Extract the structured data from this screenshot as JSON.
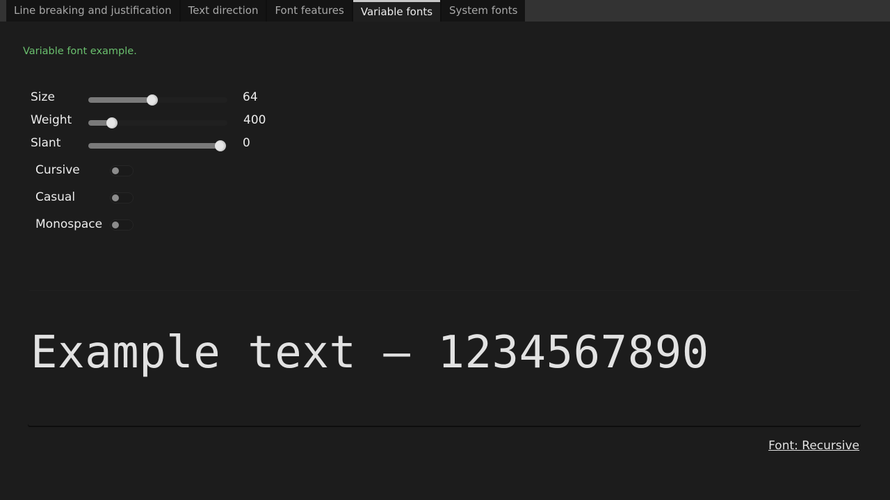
{
  "tabs": [
    {
      "label": "Line breaking and justification",
      "active": false
    },
    {
      "label": "Text direction",
      "active": false
    },
    {
      "label": "Font features",
      "active": false
    },
    {
      "label": "Variable fonts",
      "active": true
    },
    {
      "label": "System fonts",
      "active": false
    }
  ],
  "description": "Variable font example.",
  "description_color": "#6abf6e",
  "controls": {
    "sliders": [
      {
        "label": "Size",
        "value": "64",
        "fraction": 0.46
      },
      {
        "label": "Weight",
        "value": "400",
        "fraction": 0.17
      },
      {
        "label": "Slant",
        "value": "0",
        "fraction": 0.95
      }
    ],
    "toggles": [
      {
        "label": "Cursive",
        "on": false
      },
      {
        "label": "Casual",
        "on": false
      },
      {
        "label": "Monospace",
        "on": false
      }
    ]
  },
  "preview": {
    "text": "Example text – 1234567890"
  },
  "font_link": "Font: Recursive"
}
